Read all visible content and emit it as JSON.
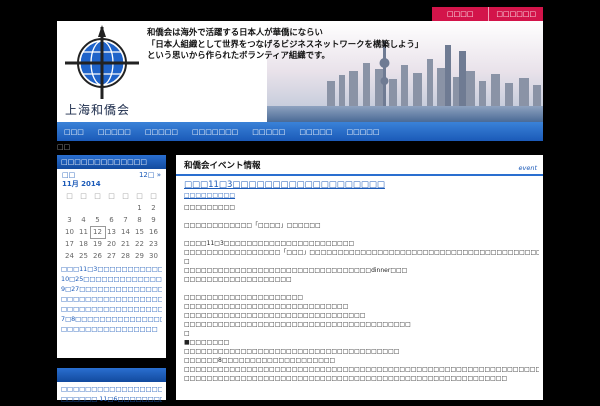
{
  "top_tabs": [
    "□□□□",
    "□□□□□□"
  ],
  "header": {
    "logo_text": "上海和僑会",
    "tagline": [
      "和僑会は海外で活躍する日本人が華僑にならい",
      "「日本人組織として世界をつなげるビジネスネットワークを構築しよう」",
      "という思いから作られたボランティア組織です。"
    ]
  },
  "nav": [
    "□□□",
    "□□□□□",
    "□□□□□",
    "□□□□□□□",
    "□□□□□",
    "□□□□□",
    "□□□□□"
  ],
  "home_icon": "□□",
  "calendar": {
    "head": "□□□□□□□□□□□□□",
    "prev": "□□",
    "next": "12□ »",
    "month": "11月 2014",
    "dow": [
      "□",
      "□",
      "□",
      "□",
      "□",
      "□",
      "□"
    ],
    "days": [
      "",
      "",
      "",
      "",
      "",
      "1",
      "2",
      "3",
      "4",
      "5",
      "6",
      "7",
      "8",
      "9",
      "10",
      "11",
      "12",
      "13",
      "14",
      "15",
      "16",
      "17",
      "18",
      "19",
      "20",
      "21",
      "22",
      "23",
      "24",
      "25",
      "26",
      "27",
      "28",
      "29",
      "30"
    ],
    "today": "12",
    "events": [
      "□□□11□3□□□□□□□□□□□□□□□□□□□",
      "10□25□□□□□□□□□□□□□□□□□6□□□□□□",
      "9□27□□□□□□□□□□□□□□□",
      "□□□□□□□□□□□□□□□□□□□□□□5□□□□",
      "□□□□□□□□□□□□□□□□□□□1□",
      "7□8□□□□□□□□□□□□□□□□□□□□□□□□",
      "□□□□□□□□□□□□□□□□"
    ]
  },
  "side2": {
    "head": "",
    "items": [
      "□□□□□□□□□□□□□□□□□□□□",
      "□□□□□□ 11□6□□□□□□□□□□□"
    ]
  },
  "main": {
    "title": "和僑会イベント情報",
    "tag": "event",
    "post_title": "□□□11□3□□□□□□□□□□□□□□□□□□□",
    "post_sub": "□□□□□□□□□",
    "lines": [
      "□□□□□□□□□",
      "",
      "□□□□□□□□□□□□「□□□□」□□□□□□",
      "",
      "□□□□11□3□□□□□□□□□□□□□□□□□□□□□□□",
      "□□□□□□□□□□□□□□□□□「□□□」□□□□□□□□□□□□□□□□□□□□□□□□□□□□□□□□□□□□□□□□□□□□□□",
      "□",
      "□□□□□□□□□□□□□□□□□□□□□□□□□□□□□□□□□dinner□□□",
      "□□□□□□□□□□□□□□□□□□□",
      "",
      "□□□□□□□□□□□□□□□□□□□□□",
      "□□□□□□□□□□□□□□□□□□□□□□□□□□□□□",
      "□□□□□□□□□□□□□□□□□□□□□□□□□□□□□□□□",
      "□□□□□□□□□□□□□□□□□□□□□□□□□□□□□□□□□□□□□□□□",
      "□",
      "■□□□□□□□",
      "□□□□□□□□□□□□□□□□□□□□□□□□□□□□□□□□□□□□□□",
      "□□□□□□8□□□□□□□□□□□□□□□□□□□□",
      "□□□□□□□□□□□□□□□□□□□□□□□□□□□□□□□□□□□□□□□□□□□□□□□□□□□□□□□□□□□□□□□",
      "□□□□□□□□□□□□□□□□□□□□□□□□□□□□□□□□□□□□□□□□□□□□□□□□□□□□□□□□□"
    ]
  }
}
